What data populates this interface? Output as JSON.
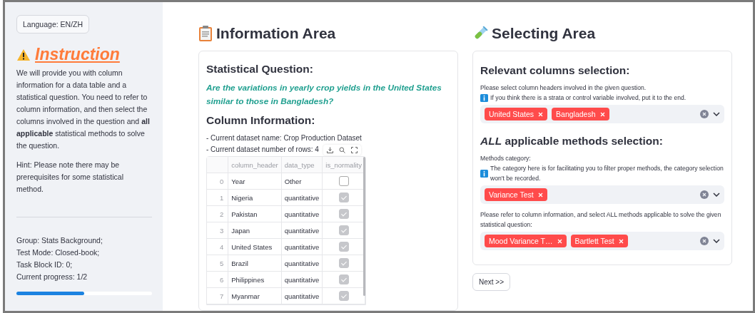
{
  "sidebar": {
    "language_button": "Language: EN/ZH",
    "instruction_title": "Instruction",
    "instruction_text": "We will provide you with column information for a data table and a statistical question. You need to refer to column information, and then select the columns involved in the question and **all applicable** statistical methods to solve the question.",
    "hint": "Hint: Please note there may be prerequisites for some statistical method.",
    "status_lines": [
      "Group: Stats Background;",
      "Test Mode: Closed-book;",
      "Task Block ID: 0;",
      "Current progress: 1/2"
    ],
    "progress": {
      "level": 0.5
    }
  },
  "information_area": {
    "title": "Information Area",
    "question_heading": "Statistical Question:",
    "question": "Are the variations in yearly crop yields in the United States similar to those in Bangladesh?",
    "column_heading": "Column Information:",
    "dataset_name": "- Current dataset name: Crop Production Dataset",
    "dataset_rows": "- Current dataset number of rows: 4",
    "table": {
      "columns": [
        "column_header",
        "data_type",
        "is_normality"
      ],
      "rows": [
        {
          "index": "0",
          "column_header": "Year",
          "data_type": "Other",
          "is_normality": false
        },
        {
          "index": "1",
          "column_header": "Nigeria",
          "data_type": "quantitative",
          "is_normality": true
        },
        {
          "index": "2",
          "column_header": "Pakistan",
          "data_type": "quantitative",
          "is_normality": true
        },
        {
          "index": "3",
          "column_header": "Japan",
          "data_type": "quantitative",
          "is_normality": true
        },
        {
          "index": "4",
          "column_header": "United States",
          "data_type": "quantitative",
          "is_normality": true
        },
        {
          "index": "5",
          "column_header": "Brazil",
          "data_type": "quantitative",
          "is_normality": true
        },
        {
          "index": "6",
          "column_header": "Philippines",
          "data_type": "quantitative",
          "is_normality": true
        },
        {
          "index": "7",
          "column_header": "Myanmar",
          "data_type": "quantitative",
          "is_normality": true
        }
      ]
    }
  },
  "selecting_area": {
    "title": "Selecting Area",
    "sections": [
      {
        "heading": "Relevant columns selection:",
        "fields": [
          {
            "label": "Please select column headers involved in the given question.",
            "note": "If you think there is a strata or control variable involved, put it to the end.",
            "tags": [
              "United States",
              "Bangladesh"
            ]
          }
        ]
      },
      {
        "heading": "*ALL* applicable methods selection:",
        "fields": [
          {
            "label": "Methods category:",
            "note": "The category here is for facilitating you to filter proper methods, the category selection won't be recorded.",
            "tags": [
              "Variance Test"
            ]
          },
          {
            "label": "Please refer to column information, and select ALL methods applicable to solve the given statistical question:",
            "tags": [
              "Mood Variance T…",
              "Bartlett Test"
            ]
          }
        ]
      }
    ],
    "next_button": "Next >>"
  }
}
